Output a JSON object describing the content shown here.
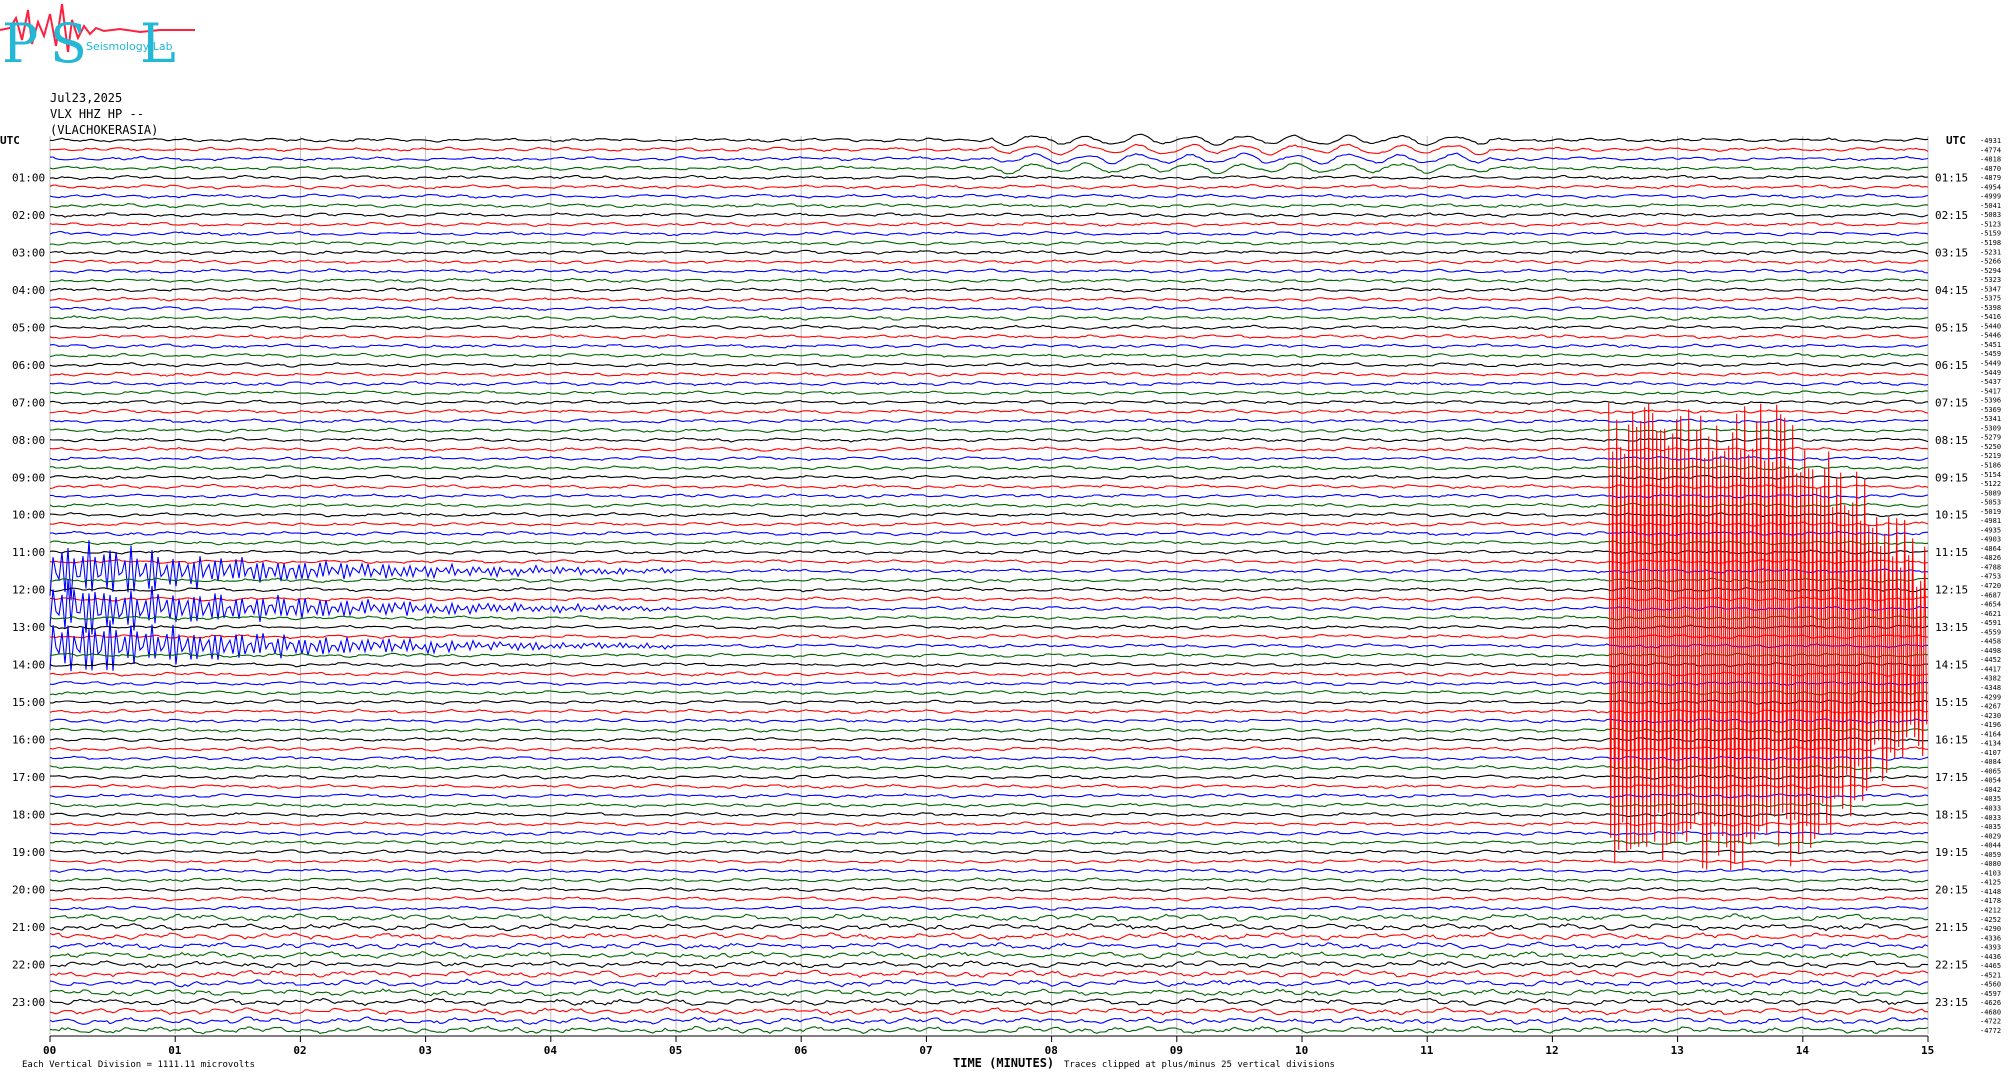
{
  "header": {
    "date": "Jul23,2025",
    "channel": "VLX HHZ HP --",
    "station": "(VLACHOKERASIA)"
  },
  "logo": {
    "letters": "PSL",
    "subtext": "Seismology Lab",
    "colors": {
      "letters": "#22b8d6",
      "wave": "#ff2040"
    }
  },
  "footer": {
    "left_note": "Each Vertical Division = 1111.11 microvolts",
    "x_title": "TIME (MINUTES)",
    "clip_note": "Traces clipped at plus/minus 25 vertical divisions"
  },
  "chart_data": {
    "type": "line",
    "title": "",
    "xlabel": "TIME (MINUTES)",
    "xlim": [
      0,
      15
    ],
    "x_ticks": [
      "00",
      "01",
      "02",
      "03",
      "04",
      "05",
      "06",
      "07",
      "08",
      "09",
      "10",
      "11",
      "12",
      "13",
      "14",
      "15"
    ],
    "left_axis_label": "UTC",
    "right_axis_label": "UTC",
    "left_ticks": [
      "01:00",
      "02:00",
      "03:00",
      "04:00",
      "05:00",
      "06:00",
      "07:00",
      "08:00",
      "09:00",
      "10:00",
      "11:00",
      "12:00",
      "13:00",
      "14:00",
      "15:00",
      "16:00",
      "17:00",
      "18:00",
      "19:00",
      "20:00",
      "21:00",
      "22:00",
      "23:00"
    ],
    "right_ticks": [
      "01:15",
      "02:15",
      "03:15",
      "04:15",
      "05:15",
      "06:15",
      "07:15",
      "08:15",
      "09:15",
      "10:15",
      "11:15",
      "12:15",
      "13:15",
      "14:15",
      "15:15",
      "16:15",
      "17:15",
      "18:15",
      "19:15",
      "20:15",
      "21:15",
      "22:15",
      "23:15"
    ],
    "trace_colors": [
      "#000000",
      "#ff0000",
      "#0000ff",
      "#006600"
    ],
    "trace_count": 96,
    "trace_offsets": [
      -4931,
      -4774,
      -4818,
      -4870,
      -4879,
      -4954,
      -4999,
      -5041,
      -5083,
      -5123,
      -5159,
      -5198,
      -5231,
      -5266,
      -5294,
      -5323,
      -5347,
      -5375,
      -5398,
      -5416,
      -5440,
      -5446,
      -5451,
      -5459,
      -5449,
      -5449,
      -5437,
      -5417,
      -5396,
      -5369,
      -5341,
      -5309,
      -5279,
      -5250,
      -5219,
      -5186,
      -5154,
      -5122,
      -5089,
      -5053,
      -5019,
      -4981,
      -4935,
      -4903,
      -4864,
      -4826,
      -4788,
      -4753,
      -4720,
      -4687,
      -4654,
      -4621,
      -4591,
      -4559,
      -4458,
      -4498,
      -4452,
      -4417,
      -4382,
      -4348,
      -4299,
      -4267,
      -4230,
      -4196,
      -4164,
      -4134,
      -4107,
      -4084,
      -4065,
      -4054,
      -4042,
      -4035,
      -4033,
      -4033,
      -4035,
      -4029,
      -4044,
      -4059,
      -4080,
      -4103,
      -4125,
      -4148,
      -4178,
      -4212,
      -4252,
      -4290,
      -4336,
      -4393,
      -4436,
      -4465,
      -4521,
      -4560,
      -4597,
      -4626,
      -4680,
      -4722
    ],
    "final_offset": -4772
  }
}
